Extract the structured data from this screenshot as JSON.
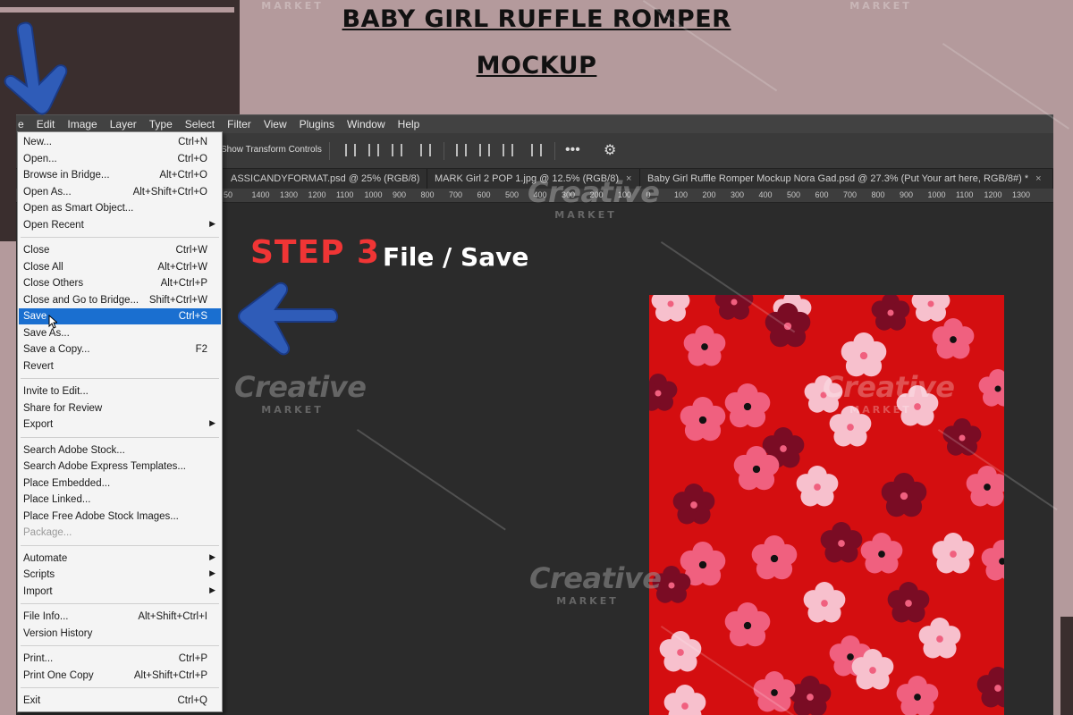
{
  "title": {
    "line1": "BABY GIRL RUFFLE ROMPER",
    "line2": "MOCKUP"
  },
  "photoshop": {
    "menubar": [
      "e",
      "Edit",
      "Image",
      "Layer",
      "Type",
      "Select",
      "Filter",
      "View",
      "Plugins",
      "Window",
      "Help"
    ],
    "options": {
      "show_transform_controls": "Show Transform Controls"
    },
    "tabs": [
      {
        "label": "ASSICANDYFORMAT.psd @ 25% (RGB/8)",
        "close": "×"
      },
      {
        "label": "MARK Girl 2 POP 1.jpg @ 12.5% (RGB/8)",
        "close": "×"
      },
      {
        "label": "Baby Girl Ruffle Romper Mockup Nora Gad.psd @ 27.3% (Put Your art here, RGB/8#) *",
        "close": "×"
      }
    ],
    "ruler": [
      "50",
      "1400",
      "1300",
      "1200",
      "1100",
      "1000",
      "900",
      "800",
      "700",
      "600",
      "500",
      "400",
      "300",
      "200",
      "100",
      "0",
      "100",
      "200",
      "300",
      "400",
      "500",
      "600",
      "700",
      "800",
      "900",
      "1000",
      "1100",
      "1200",
      "1300"
    ]
  },
  "file_menu": {
    "groups": [
      [
        {
          "label": "New...",
          "shortcut": "Ctrl+N"
        },
        {
          "label": "Open...",
          "shortcut": "Ctrl+O"
        },
        {
          "label": "Browse in Bridge...",
          "shortcut": "Alt+Ctrl+O"
        },
        {
          "label": "Open As...",
          "shortcut": "Alt+Shift+Ctrl+O"
        },
        {
          "label": "Open as Smart Object...",
          "shortcut": ""
        },
        {
          "label": "Open Recent",
          "shortcut": "",
          "submenu": true
        }
      ],
      [
        {
          "label": "Close",
          "shortcut": "Ctrl+W"
        },
        {
          "label": "Close All",
          "shortcut": "Alt+Ctrl+W"
        },
        {
          "label": "Close Others",
          "shortcut": "Alt+Ctrl+P"
        },
        {
          "label": "Close and Go to Bridge...",
          "shortcut": "Shift+Ctrl+W"
        },
        {
          "label": "Save",
          "shortcut": "Ctrl+S",
          "selected": true
        },
        {
          "label": "Save As...",
          "shortcut": ""
        },
        {
          "label": "Save a Copy...",
          "shortcut": "F2"
        },
        {
          "label": "Revert",
          "shortcut": ""
        }
      ],
      [
        {
          "label": "Invite to Edit...",
          "shortcut": ""
        },
        {
          "label": "Share for Review",
          "shortcut": ""
        },
        {
          "label": "Export",
          "shortcut": "",
          "submenu": true
        }
      ],
      [
        {
          "label": "Search Adobe Stock...",
          "shortcut": ""
        },
        {
          "label": "Search Adobe Express Templates...",
          "shortcut": ""
        },
        {
          "label": "Place Embedded...",
          "shortcut": ""
        },
        {
          "label": "Place Linked...",
          "shortcut": ""
        },
        {
          "label": "Place Free Adobe Stock Images...",
          "shortcut": ""
        },
        {
          "label": "Package...",
          "shortcut": "",
          "disabled": true
        }
      ],
      [
        {
          "label": "Automate",
          "shortcut": "",
          "submenu": true
        },
        {
          "label": "Scripts",
          "shortcut": "",
          "submenu": true
        },
        {
          "label": "Import",
          "shortcut": "",
          "submenu": true
        }
      ],
      [
        {
          "label": "File Info...",
          "shortcut": "Alt+Shift+Ctrl+I"
        },
        {
          "label": "Version History",
          "shortcut": ""
        }
      ],
      [
        {
          "label": "Print...",
          "shortcut": "Ctrl+P"
        },
        {
          "label": "Print One Copy",
          "shortcut": "Alt+Shift+Ctrl+P"
        }
      ],
      [
        {
          "label": "Exit",
          "shortcut": "Ctrl+Q"
        }
      ]
    ]
  },
  "step": {
    "label": "STEP 3",
    "action": "File / Save"
  },
  "watermark": {
    "big": "Creative",
    "small": "MARKET"
  },
  "colors": {
    "background": "#b49a9c",
    "step_red": "#f03535",
    "menu_selected": "#1a6fd0",
    "arrow_blue": "#2f5cb8",
    "fabric_red": "#d40e10",
    "flower_light": "#f7c0cd",
    "flower_pink": "#f0607f",
    "flower_dark": "#7a0c24"
  },
  "icons": [
    "down-arrow-icon",
    "left-arrow-icon",
    "gear-icon",
    "more-icon",
    "cursor-icon",
    "align-icon",
    "submenu-arrow-icon"
  ]
}
